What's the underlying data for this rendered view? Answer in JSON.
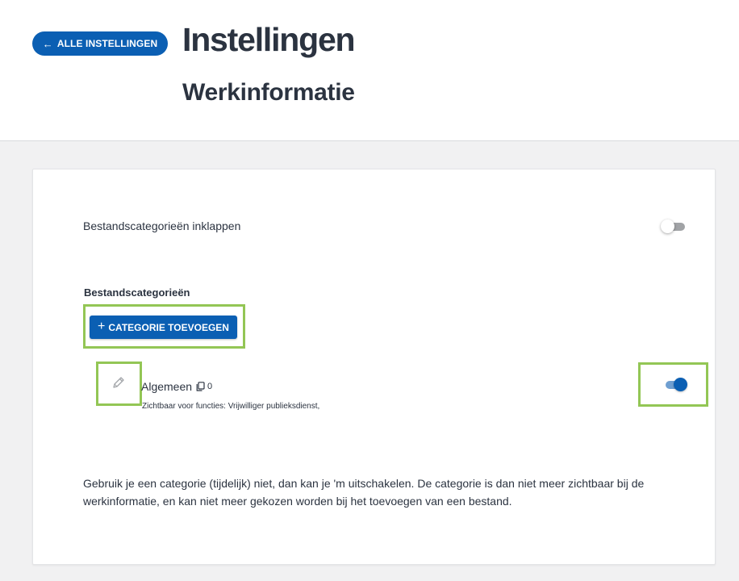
{
  "header": {
    "back_label": "ALLE INSTELLINGEN",
    "title": "Instellingen",
    "subtitle": "Werkinformatie"
  },
  "settings": {
    "collapse_label": "Bestandscategorieën inklappen",
    "collapse_enabled": false
  },
  "categories_section": {
    "heading": "Bestandscategorieën",
    "add_button_label": "CATEGORIE TOEVOEGEN",
    "items": [
      {
        "name": "Algemeen",
        "file_count": "0",
        "visibility": "Zichtbaar voor functies: Vrijwilliger publieksdienst,",
        "enabled": true
      }
    ]
  },
  "help_text": "Gebruik je een categorie (tijdelijk) niet, dan kan je 'm uitschakelen. De categorie is dan niet meer zichtbaar bij de werkinformatie, en kan niet meer gekozen worden bij het toevoegen van een bestand.",
  "colors": {
    "primary": "#0b5fb3",
    "highlight": "#93c655",
    "text": "#2b3340",
    "background": "#f1f1f2"
  },
  "icons": {
    "back": "arrow-left-icon",
    "add": "plus-icon",
    "edit": "pencil-icon",
    "count": "copy-icon"
  }
}
